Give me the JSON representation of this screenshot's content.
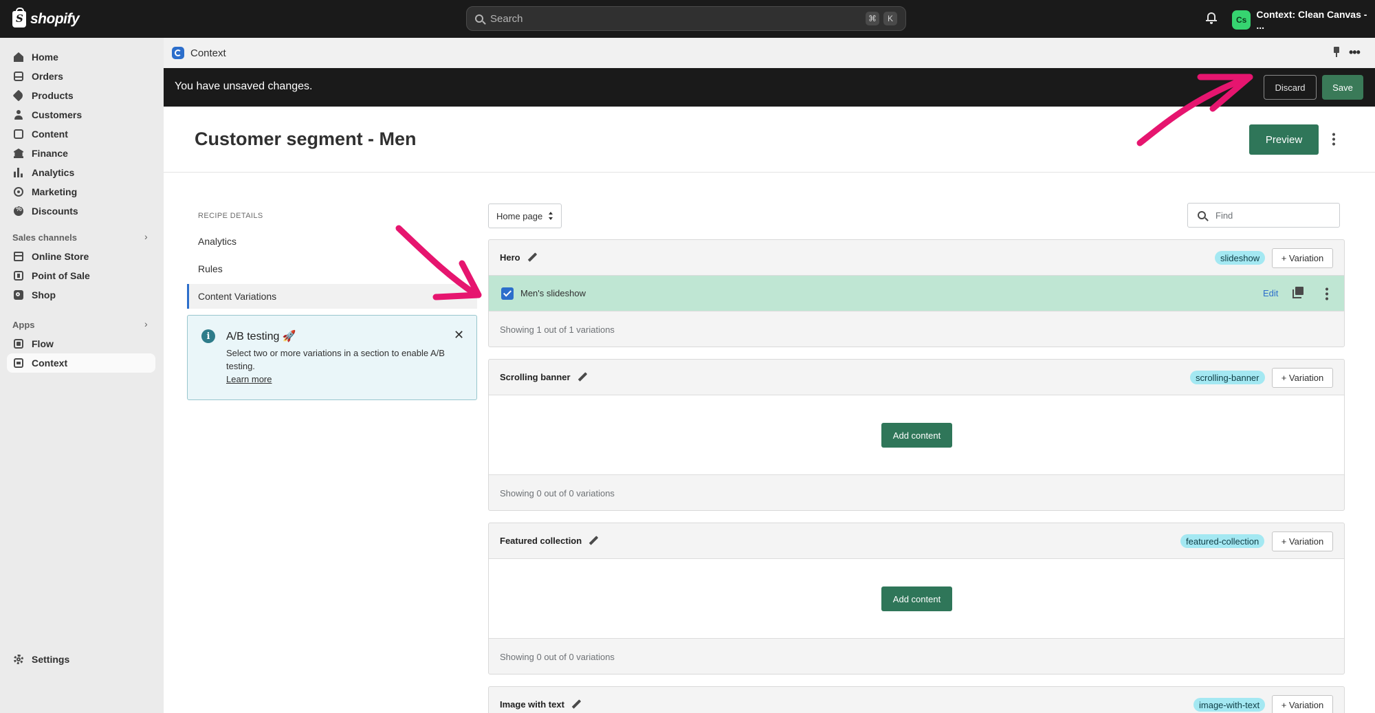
{
  "topbar": {
    "logo_text": "shopify",
    "search_placeholder": "Search",
    "shortcut_keys": [
      "⌘",
      "K"
    ],
    "store_avatar": "Cs",
    "store_name": "Context: Clean Canvas - ..."
  },
  "sidebar": {
    "items": [
      {
        "label": "Home",
        "icon": "home-icon"
      },
      {
        "label": "Orders",
        "icon": "inbox-icon"
      },
      {
        "label": "Products",
        "icon": "tag-icon"
      },
      {
        "label": "Customers",
        "icon": "person-icon"
      },
      {
        "label": "Content",
        "icon": "content-icon"
      },
      {
        "label": "Finance",
        "icon": "bank-icon"
      },
      {
        "label": "Analytics",
        "icon": "bar-chart-icon"
      },
      {
        "label": "Marketing",
        "icon": "target-icon"
      },
      {
        "label": "Discounts",
        "icon": "discount-icon"
      }
    ],
    "sales_channels_label": "Sales channels",
    "channels": [
      {
        "label": "Online Store",
        "icon": "store-icon"
      },
      {
        "label": "Point of Sale",
        "icon": "pos-icon"
      },
      {
        "label": "Shop",
        "icon": "shop-icon"
      }
    ],
    "apps_label": "Apps",
    "apps": [
      {
        "label": "Flow",
        "icon": "flow-icon"
      },
      {
        "label": "Context",
        "icon": "context-icon",
        "active": true
      }
    ],
    "settings_label": "Settings"
  },
  "app": {
    "title": "Context"
  },
  "savebar": {
    "message": "You have unsaved changes.",
    "discard_label": "Discard",
    "save_label": "Save"
  },
  "page": {
    "title": "Customer segment - Men",
    "preview_label": "Preview"
  },
  "recipe": {
    "heading": "RECIPE DETAILS",
    "items": [
      "Analytics",
      "Rules",
      "Content Variations"
    ],
    "active_item": "Content Variations"
  },
  "ab_testing": {
    "title": "A/B testing 🚀",
    "text": "Select two or more variations in a section to enable A/B testing.",
    "link": "Learn more"
  },
  "toolbar": {
    "page_select": "Home page",
    "find_placeholder": "Find"
  },
  "sections": [
    {
      "title": "Hero",
      "tag": "slideshow",
      "add_variation": "+ Variation",
      "variations": [
        {
          "name": "Men's slideshow",
          "checked": true,
          "edit": "Edit"
        }
      ],
      "footer": "Showing 1 out of 1 variations"
    },
    {
      "title": "Scrolling banner",
      "tag": "scrolling-banner",
      "add_variation": "+ Variation",
      "add_content": "Add content",
      "footer": "Showing 0 out of 0 variations"
    },
    {
      "title": "Featured collection",
      "tag": "featured-collection",
      "add_variation": "+ Variation",
      "add_content": "Add content",
      "footer": "Showing 0 out of 0 variations"
    },
    {
      "title": "Image with text",
      "tag": "image-with-text",
      "add_variation": "+ Variation"
    }
  ],
  "colors": {
    "primary_green": "#2f7659",
    "annotation_arrow": "#e6156f",
    "selected_row": "#bfe6d3",
    "tag_bg": "#a4e8f2"
  }
}
